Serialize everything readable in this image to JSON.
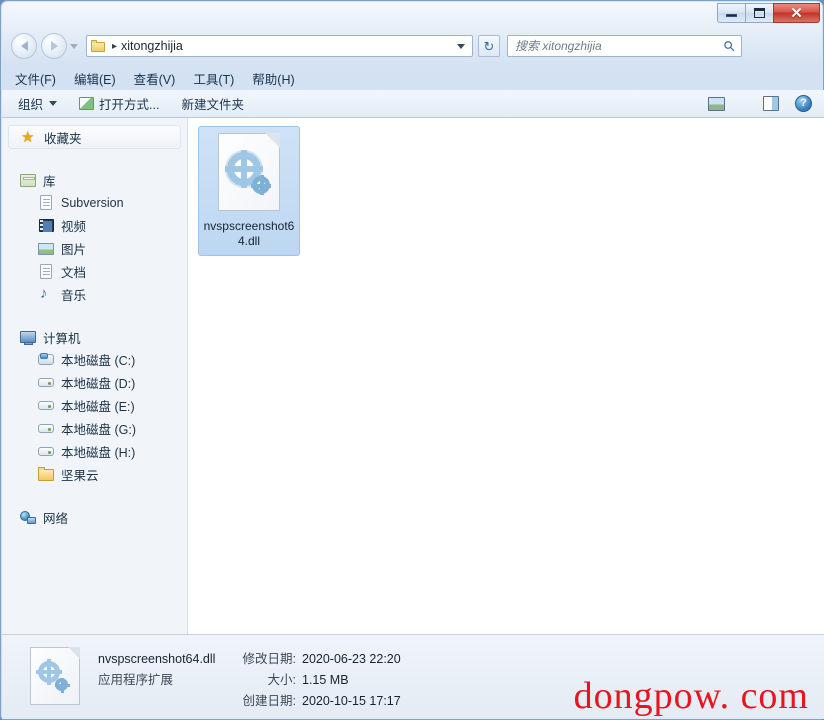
{
  "window": {
    "title": "",
    "buttons": {
      "minimize": "minimize",
      "maximize": "maximize",
      "close": "✕"
    }
  },
  "address_bar": {
    "path": "xitongzhijia",
    "separator": "▸",
    "refresh_icon": "↻"
  },
  "search": {
    "placeholder": "搜索 xitongzhijia",
    "value": "",
    "icon": "⚲"
  },
  "menu": {
    "items": [
      {
        "label": "文件(F)"
      },
      {
        "label": "编辑(E)"
      },
      {
        "label": "查看(V)"
      },
      {
        "label": "工具(T)"
      },
      {
        "label": "帮助(H)"
      }
    ]
  },
  "toolbar": {
    "organize_label": "组织",
    "open_with_label": "打开方式...",
    "new_folder_label": "新建文件夹",
    "help_glyph": "?"
  },
  "sidebar": {
    "groups": [
      {
        "head": {
          "label": "收藏夹",
          "icon": "star-icon",
          "highlight": true
        },
        "children": []
      },
      {
        "head": {
          "label": "库",
          "icon": "library-icon",
          "highlight": false
        },
        "children": [
          {
            "label": "Subversion",
            "icon": "document-icon"
          },
          {
            "label": "视频",
            "icon": "video-icon"
          },
          {
            "label": "图片",
            "icon": "pictures-icon"
          },
          {
            "label": "文档",
            "icon": "documents-icon"
          },
          {
            "label": "音乐",
            "icon": "music-icon"
          }
        ]
      },
      {
        "head": {
          "label": "计算机",
          "icon": "computer-icon",
          "highlight": false
        },
        "children": [
          {
            "label": "本地磁盘 (C:)",
            "icon": "system-drive-icon"
          },
          {
            "label": "本地磁盘 (D:)",
            "icon": "drive-icon"
          },
          {
            "label": "本地磁盘 (E:)",
            "icon": "drive-icon"
          },
          {
            "label": "本地磁盘 (G:)",
            "icon": "drive-icon"
          },
          {
            "label": "本地磁盘 (H:)",
            "icon": "drive-icon"
          },
          {
            "label": "坚果云",
            "icon": "folder-icon"
          }
        ]
      },
      {
        "head": {
          "label": "网络",
          "icon": "network-icon",
          "highlight": false
        },
        "children": []
      }
    ]
  },
  "content": {
    "files": [
      {
        "name": "nvspscreenshot64.dll",
        "icon": "gears-dll-icon",
        "selected": true
      }
    ]
  },
  "status": {
    "file_name": "nvspscreenshot64.dll",
    "file_type": "应用程序扩展",
    "modified_label": "修改日期:",
    "modified_value": "2020-06-23 22:20",
    "size_label": "大小:",
    "size_value": "1.15 MB",
    "created_label": "创建日期:",
    "created_value": "2020-10-15 17:17"
  },
  "watermark": {
    "text": "dongpow. com",
    "color": "#e8141e"
  },
  "colors": {
    "frame": "#d4e2f2",
    "selection": "#bdd7f2",
    "close_button": "#bf3427",
    "sidebar_bg": "#f1f5fa"
  }
}
